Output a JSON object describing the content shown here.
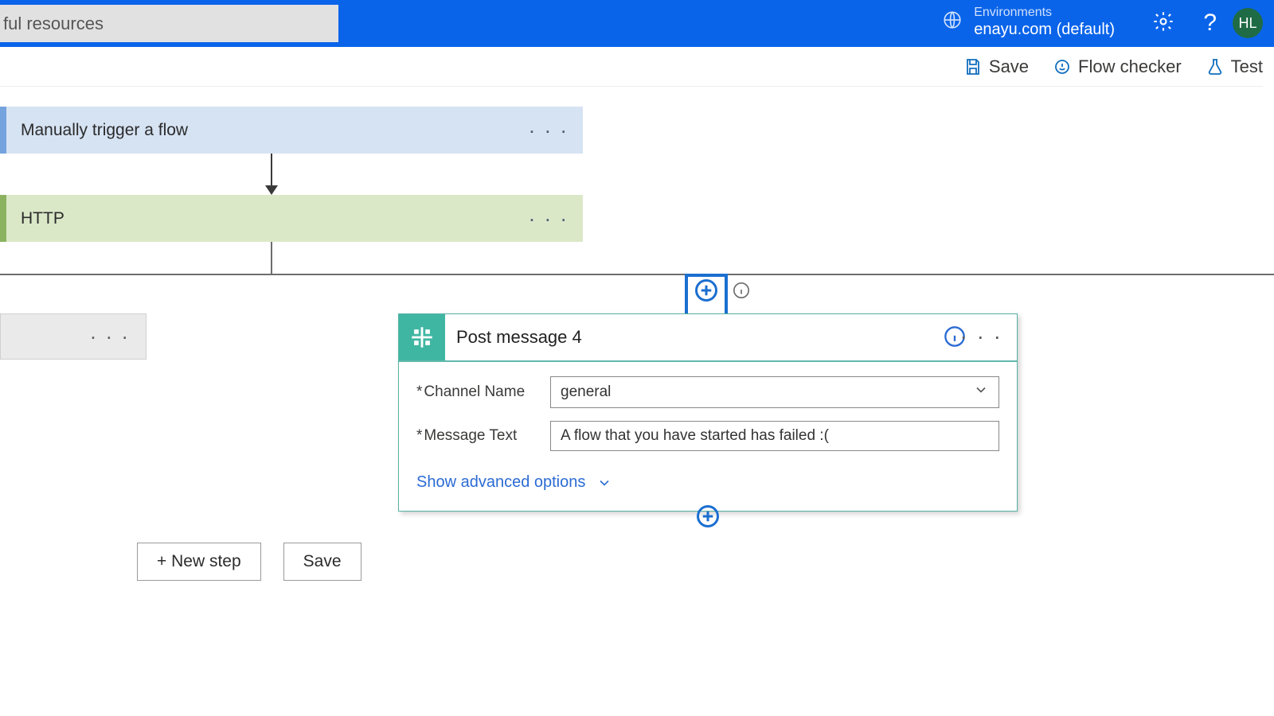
{
  "search": {
    "value": "ful resources"
  },
  "env": {
    "label": "Environments",
    "value": "enayu.com (default)"
  },
  "avatar": "HL",
  "actions": {
    "save": "Save",
    "checker": "Flow checker",
    "test": "Test"
  },
  "cards": {
    "trigger": "Manually trigger a flow",
    "http": "HTTP",
    "post_title": "Post message 4"
  },
  "form": {
    "channel_label": "Channel Name",
    "channel_value": "general",
    "message_label": "Message Text",
    "message_value": "A flow that you have started has failed :(",
    "adv": "Show advanced options"
  },
  "buttons": {
    "new_step": "+ New step",
    "save": "Save"
  }
}
